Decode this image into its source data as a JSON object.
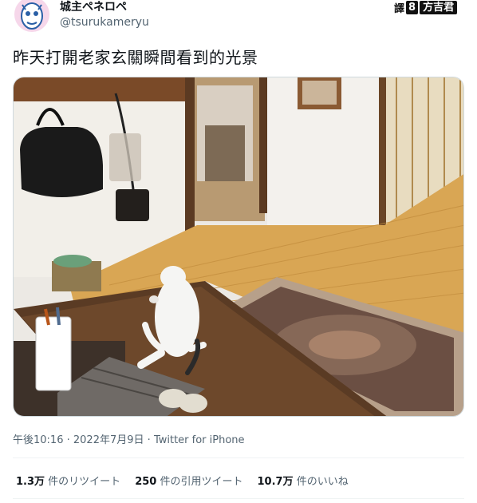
{
  "author": {
    "display_name": "城主ペネロペ",
    "handle": "@tsurukameryu",
    "avatar_icon": "cat-avatar-icon"
  },
  "translator_badge": {
    "label_a": "譯",
    "number": "8",
    "label_b": "方吉君"
  },
  "tweet": {
    "text": "昨天打開老家玄關瞬間看到的光景"
  },
  "meta": {
    "time": "午後10:16",
    "separator": "·",
    "date": "2022年7月9日",
    "source": "Twitter for iPhone"
  },
  "stats": {
    "retweets_count": "1.3万",
    "retweets_label": "件のリツイート",
    "quotes_count": "250",
    "quotes_label": "件の引用ツイート",
    "likes_count": "10.7万",
    "likes_label": "件のいいね"
  },
  "colors": {
    "text": "#0f1419",
    "muted": "#536471",
    "border": "#eff3f4"
  }
}
